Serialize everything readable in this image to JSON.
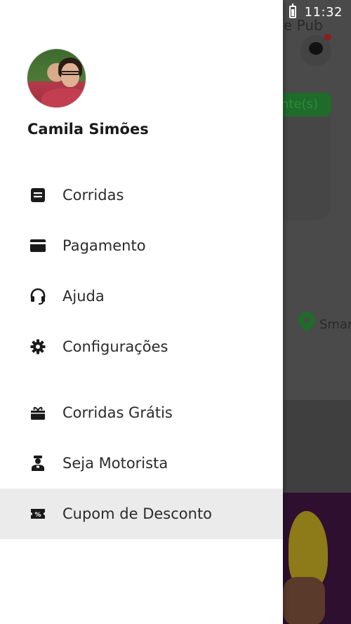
{
  "status_bar": {
    "time": "11:32"
  },
  "background": {
    "map_label_top": "e Pub",
    "green_pill_text": "nte(s)",
    "map_label_right": "Smar"
  },
  "drawer": {
    "user_name": "Camila Simões",
    "menu_primary": [
      {
        "label": "Corridas",
        "icon": "receipt-icon"
      },
      {
        "label": "Pagamento",
        "icon": "credit-card-icon"
      },
      {
        "label": "Ajuda",
        "icon": "headset-icon"
      },
      {
        "label": "Configurações",
        "icon": "settings-icon"
      }
    ],
    "menu_secondary": [
      {
        "label": "Corridas Grátis",
        "icon": "gift-icon"
      },
      {
        "label": "Seja Motorista",
        "icon": "driver-icon"
      },
      {
        "label": "Cupom de Desconto",
        "icon": "discount-coupon-icon",
        "active": true
      }
    ]
  },
  "colors": {
    "drawer_bg": "#ffffff",
    "active_item_bg": "#ebebeb",
    "text": "#2b2b2b",
    "accent_green": "#1f6b2a"
  }
}
